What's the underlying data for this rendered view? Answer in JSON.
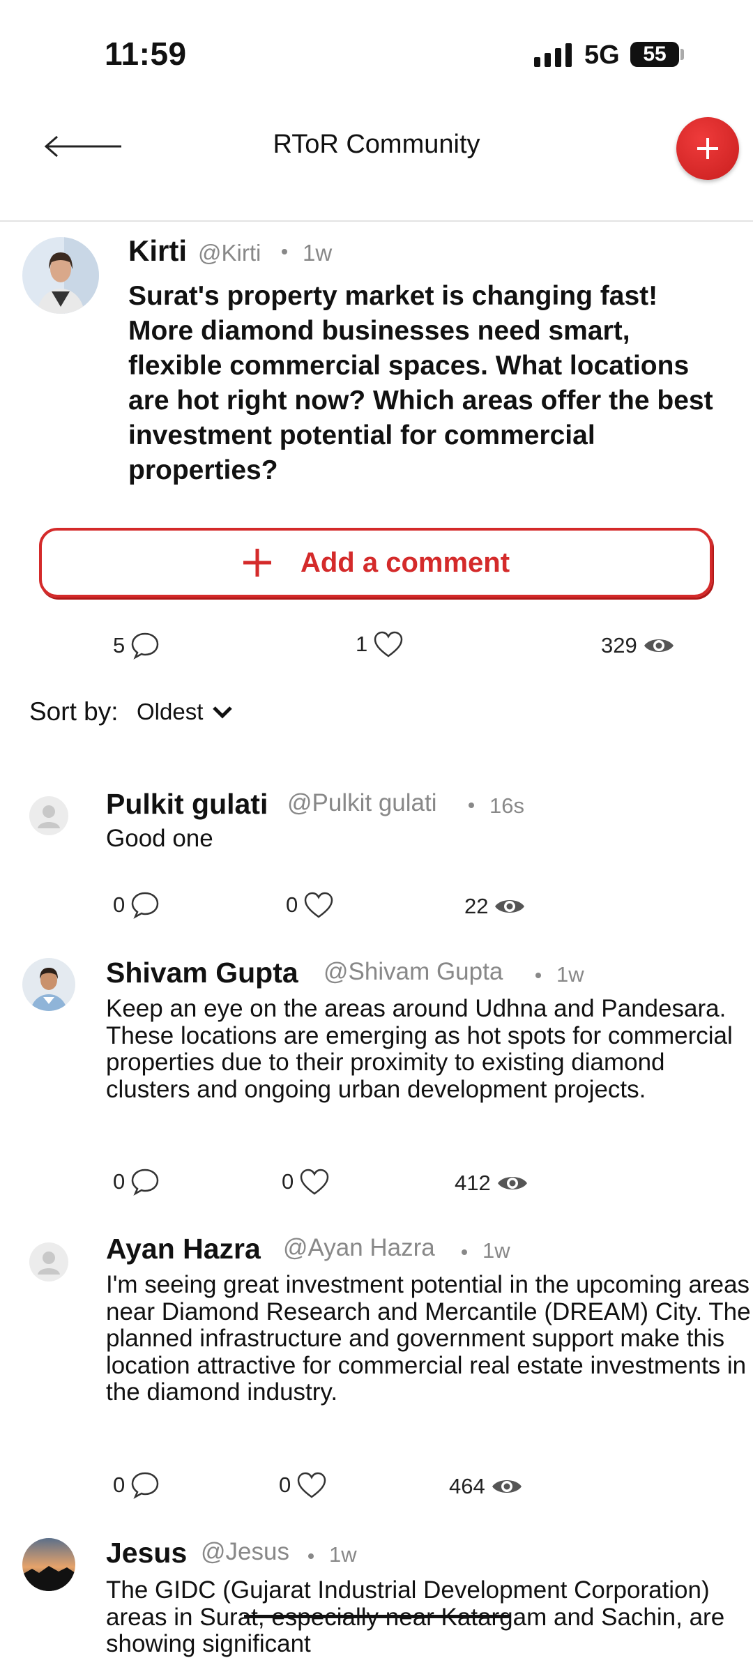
{
  "status_bar": {
    "time": "11:59",
    "network": "5G",
    "battery": "55"
  },
  "header": {
    "title": "RToR Community"
  },
  "post": {
    "author": "Kirti",
    "handle": "@Kirti",
    "time": "1w",
    "text": "Surat's property market is changing fast! More diamond businesses need smart, flexible commercial spaces. What locations are hot right now? Which areas offer the best investment potential for commercial properties?",
    "add_comment_label": "Add a comment",
    "comments_count": "5",
    "likes_count": "1",
    "views_count": "329"
  },
  "sort": {
    "label": "Sort by:",
    "value": "Oldest"
  },
  "comments": [
    {
      "name": "Pulkit gulati",
      "handle": "@Pulkit gulati",
      "time": "16s",
      "text": "Good one",
      "replies": "0",
      "likes": "0",
      "views": "22"
    },
    {
      "name": "Shivam Gupta",
      "handle": "@Shivam Gupta",
      "time": "1w",
      "text": "Keep an eye on the areas around Udhna and Pandesara. These locations are emerging as hot spots for commercial properties due to their proximity to existing diamond clusters and ongoing urban development projects.",
      "replies": "0",
      "likes": "0",
      "views": "412"
    },
    {
      "name": "Ayan Hazra",
      "handle": "@Ayan Hazra",
      "time": "1w",
      "text": "I'm seeing great investment potential in the upcoming areas near Diamond Research and Mercantile (DREAM) City. The planned infrastructure and government support make this location attractive for commercial real estate investments in the diamond industry.",
      "replies": "0",
      "likes": "0",
      "views": "464"
    },
    {
      "name": "Jesus",
      "handle": "@Jesus",
      "time": "1w",
      "text": "The GIDC (Gujarat Industrial Development Corporation) areas in Surat, especially near Katargam and Sachin, are showing significant"
    }
  ],
  "icons": {
    "back": "arrow-left-icon",
    "add": "plus-icon",
    "comment": "speech-bubble-icon",
    "like": "heart-icon",
    "views": "eye-icon",
    "chevron": "chevron-down-icon",
    "avatar": "user-placeholder-icon"
  },
  "colors": {
    "accent": "#d42a2a",
    "muted": "#888888"
  }
}
